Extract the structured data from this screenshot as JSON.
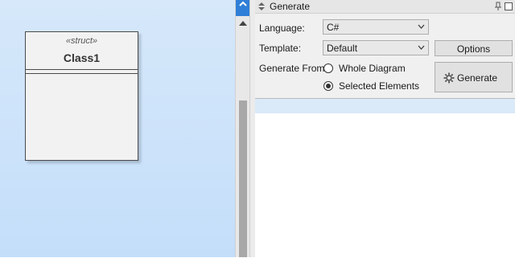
{
  "diagram": {
    "class_element": {
      "stereotype": "«struct»",
      "name": "Class1"
    }
  },
  "panel": {
    "title": "Generate",
    "language": {
      "label": "Language:",
      "value": "C#"
    },
    "template": {
      "label": "Template:",
      "value": "Default"
    },
    "options_button": "Options",
    "generate_from": {
      "label": "Generate From",
      "options": [
        {
          "label": "Whole Diagram",
          "selected": false
        },
        {
          "label": "Selected Elements",
          "selected": true
        }
      ]
    },
    "generate_button": "Generate"
  },
  "icons": {
    "collapse": "chevron-up-down-icon",
    "pin": "pin-icon",
    "restore": "restore-window-icon",
    "generate": "gear-icon"
  },
  "colors": {
    "canvas_top": "#d6e8fa",
    "canvas_bottom": "#c4defa",
    "accent_tab": "#2f7fd8",
    "output_highlight": "#daeaf9"
  }
}
